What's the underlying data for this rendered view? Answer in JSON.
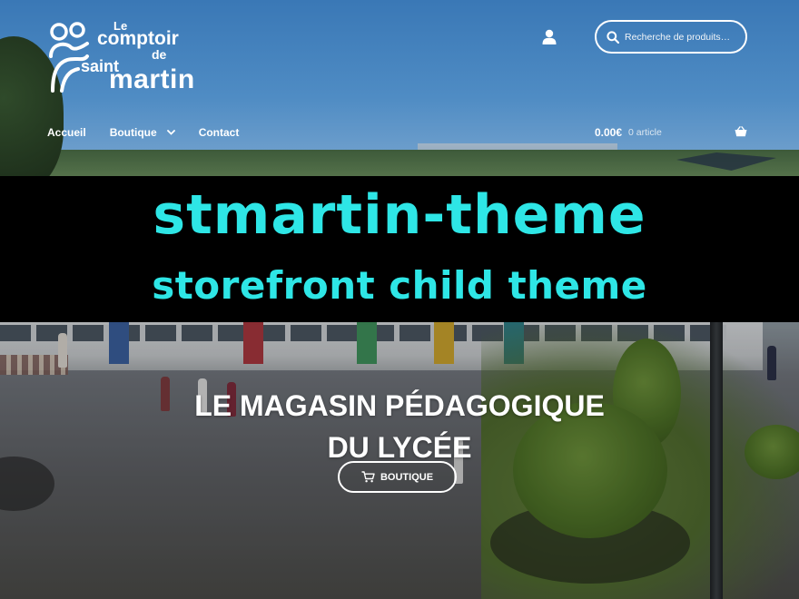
{
  "header": {
    "logo": {
      "le": "Le",
      "comptoir": "comptoir",
      "de": "de",
      "saint": "saint",
      "martin": "martin"
    },
    "account_icon": "user-icon",
    "search": {
      "placeholder": "Recherche de produits…",
      "icon": "search-icon"
    }
  },
  "nav": {
    "items": [
      {
        "label": "Accueil"
      },
      {
        "label": "Boutique",
        "has_dropdown": true,
        "icon": "chevron-down-icon"
      },
      {
        "label": "Contact"
      }
    ]
  },
  "cart": {
    "amount": "0.00€",
    "count": "0 article",
    "icon": "basket-icon"
  },
  "banner": {
    "title": "stmartin-theme",
    "subtitle": "storefront child theme",
    "text_color": "#2ee6e6",
    "background": "#000000"
  },
  "hero": {
    "heading_line1": "LE MAGASIN PÉDAGOGIQUE",
    "heading_line2": "DU LYCÉE",
    "button_label": "BOUTIQUE",
    "button_icon": "cart-icon"
  }
}
